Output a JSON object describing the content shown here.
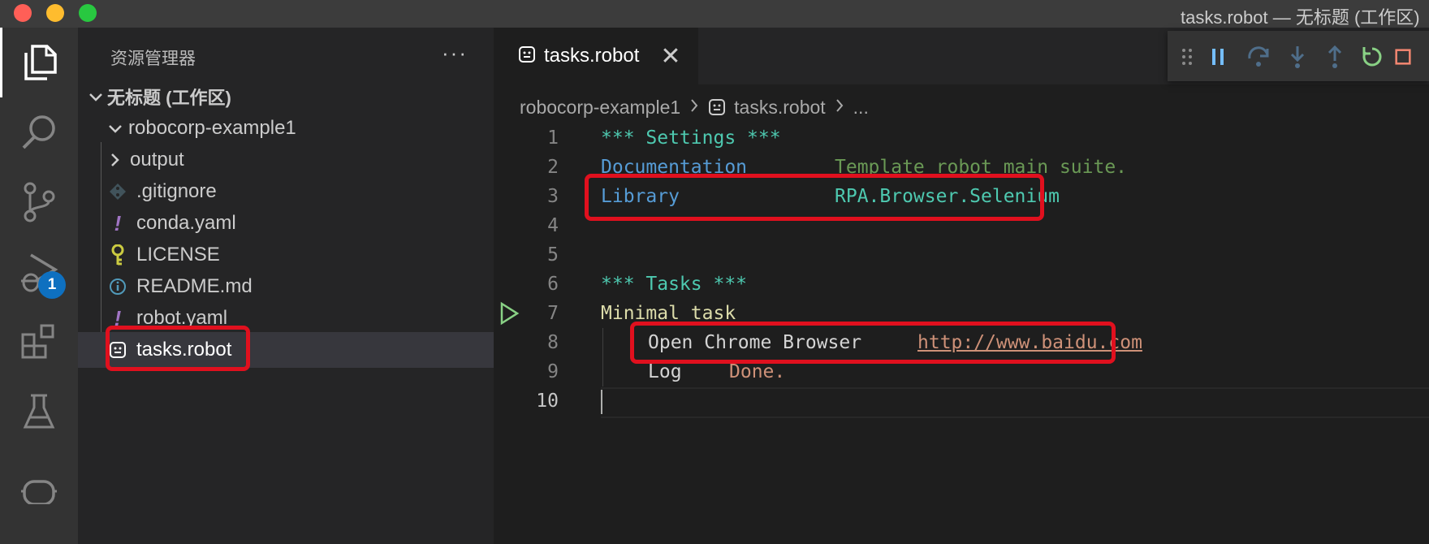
{
  "window": {
    "title": "tasks.robot — 无标题 (工作区)"
  },
  "activity": {
    "debug_badge": "1"
  },
  "sidebar": {
    "title": "资源管理器",
    "more": "···",
    "workspace": "无标题 (工作区)",
    "folder": "robocorp-example1",
    "items": [
      {
        "label": "output",
        "icon": "chevron-right-icon"
      },
      {
        "label": ".gitignore",
        "icon": "git-icon"
      },
      {
        "label": "conda.yaml",
        "icon": "yaml-exclamation-icon"
      },
      {
        "label": "LICENSE",
        "icon": "license-key-icon"
      },
      {
        "label": "README.md",
        "icon": "info-icon"
      },
      {
        "label": "robot.yaml",
        "icon": "yaml-exclamation-icon"
      },
      {
        "label": "tasks.robot",
        "icon": "robot-file-icon",
        "selected": true
      }
    ]
  },
  "editor": {
    "tab": {
      "label": "tasks.robot",
      "close": "✕"
    },
    "breadcrumb": {
      "folder": "robocorp-example1",
      "file": "tasks.robot",
      "more": "..."
    },
    "lines": {
      "n1": "1",
      "n2": "2",
      "n3": "3",
      "n4": "4",
      "n5": "5",
      "n6": "6",
      "n7": "7",
      "n8": "8",
      "n9": "9",
      "n10": "10",
      "l1": "*** Settings ***",
      "l2a": "Documentation",
      "l2b": "Template robot main suite.",
      "l3a": "Library",
      "l3b": "RPA.Browser.Selenium",
      "l6": "*** Tasks ***",
      "l7": "Minimal task",
      "l8a": "Open Chrome Browser",
      "l8b": "http://www.baidu.com",
      "l9a": "Log",
      "l9b": "Done."
    }
  },
  "colors": {
    "highlight_box": "#e0101e",
    "accent": "#0e70c0"
  }
}
